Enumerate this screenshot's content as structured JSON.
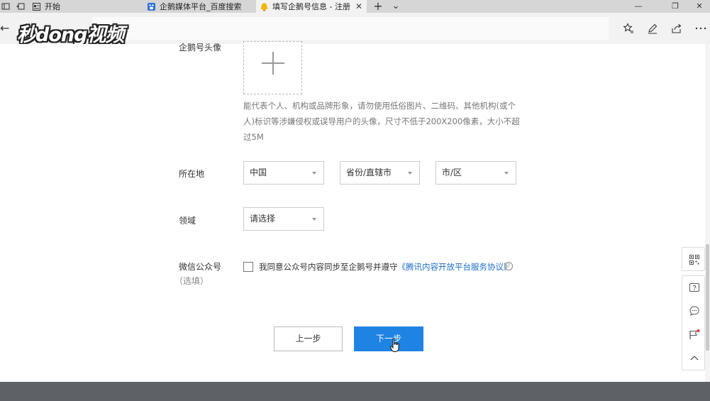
{
  "browser": {
    "tabs": [
      {
        "title": "开始"
      },
      {
        "title": "企鹅媒体平台_百度搜索"
      },
      {
        "title": "填写企鹅号信息 - 注册",
        "active": true
      }
    ],
    "new_tab_glyph": "+",
    "tab_list_glyph": "⌄",
    "watermark": "秒dong视频"
  },
  "form": {
    "avatar_label": "企鹅号头像",
    "avatar_hint": "能代表个人、机构或品牌形象，请勿使用低俗图片、二维码、其他机构(或个人)标识等涉嫌侵权或误导用户的头像，尺寸不低于200X200像素，大小不超过5M",
    "location_label": "所在地",
    "country_value": "中国",
    "province_value": "省份/直辖市",
    "city_value": "市/区",
    "domain_label": "领域",
    "domain_value": "请选择",
    "wechat_label": "微信公众号",
    "wechat_optional": "（选填）",
    "agree_text": "我同意公众号内容同步至企鹅号并遵守",
    "agree_link": "《腾讯内容开放平台服务协议》",
    "prev_button": "上一步",
    "next_button": "下一步"
  },
  "side_panel": {
    "icons": [
      "qrcode-icon",
      "help-icon",
      "chat-icon",
      "flag-icon",
      "chevron-up-icon"
    ],
    "flag_badge_color": "#e03a3a"
  },
  "colors": {
    "primary_button": "#1f83e3",
    "link": "#1f6fc8",
    "footer": "#5e6166"
  }
}
